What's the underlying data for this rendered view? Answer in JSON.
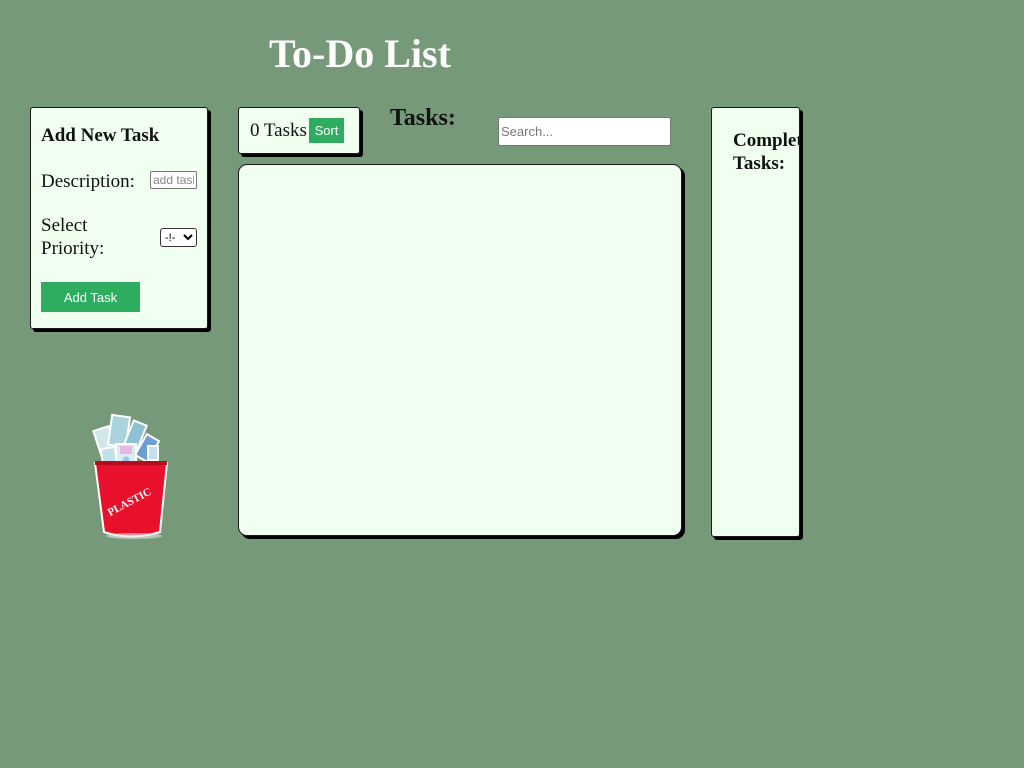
{
  "header": {
    "title": "To-Do List"
  },
  "add_task": {
    "title": "Add New Task",
    "description_label": "Description:",
    "description_placeholder": "add task",
    "priority_label": "Select Priority:",
    "priority_selected": "-!-",
    "add_button_label": "Add Task"
  },
  "task_count": {
    "text": "0 Tasks",
    "sort_label": "Sort"
  },
  "tasks": {
    "heading": "Tasks:",
    "search_placeholder": "Search...",
    "items": []
  },
  "completed": {
    "title": "Completed Tasks:"
  },
  "trash": {
    "label": "PLASTIC",
    "icon": "trash-bin-icon"
  },
  "colors": {
    "background": "#76997a",
    "panel": "#f0fff0",
    "button": "#2eac5f",
    "bin": "#e8102a"
  }
}
